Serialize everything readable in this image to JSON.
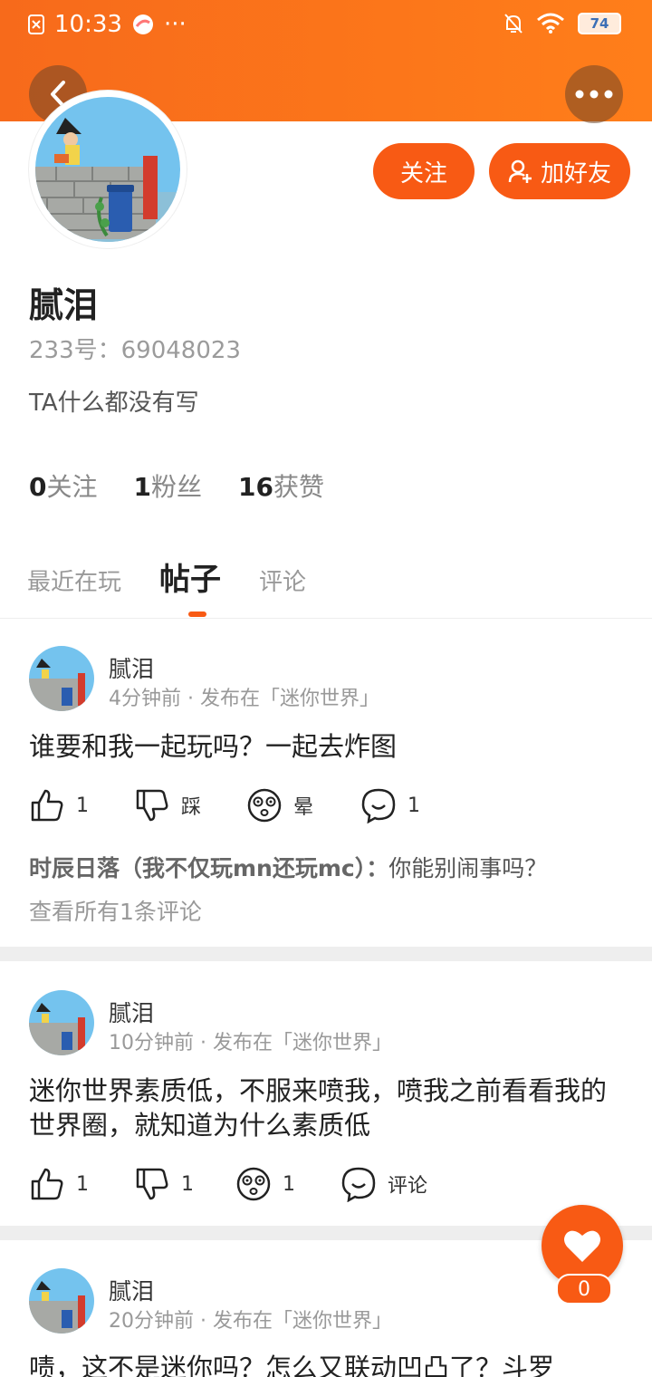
{
  "status_bar": {
    "time": "10:33",
    "more": "···",
    "battery": "74"
  },
  "profile": {
    "name": "腻泪",
    "uid_label": "233号：69048023",
    "bio": "TA什么都没有写",
    "follow_button": "关注",
    "add_friend_button": "加好友",
    "stats": [
      {
        "count": "0",
        "label": "关注"
      },
      {
        "count": "1",
        "label": "粉丝"
      },
      {
        "count": "16",
        "label": "获赞"
      }
    ]
  },
  "tabs": [
    {
      "label": "最近在玩"
    },
    {
      "label": "帖子",
      "active": true
    },
    {
      "label": "评论"
    }
  ],
  "posts": [
    {
      "author": "腻泪",
      "meta": "4分钟前 · 发布在「迷你世界」",
      "text": "谁要和我一起玩吗？一起去炸图",
      "like": "1",
      "dislike": "踩",
      "dizzy": "晕",
      "comments": "1",
      "top_comment_author": "时辰日落（我不仅玩mn还玩mc）：",
      "top_comment_text": "你能别闹事吗？",
      "view_all": "查看所有1条评论"
    },
    {
      "author": "腻泪",
      "meta": "10分钟前 · 发布在「迷你世界」",
      "text": "迷你世界素质低，不服来喷我，喷我之前看看我的世界圈，就知道为什么素质低",
      "like": "1",
      "dislike": "1",
      "dizzy": "1",
      "comments": "评论"
    },
    {
      "author": "腻泪",
      "meta": "20分钟前 · 发布在「迷你世界」",
      "text": "啧，这不是迷你吗？怎么又联动凹凸了？斗罗"
    }
  ],
  "fab": {
    "count": "0"
  },
  "colors": {
    "accent": "#f85a14",
    "header": "#ff7e1a"
  }
}
